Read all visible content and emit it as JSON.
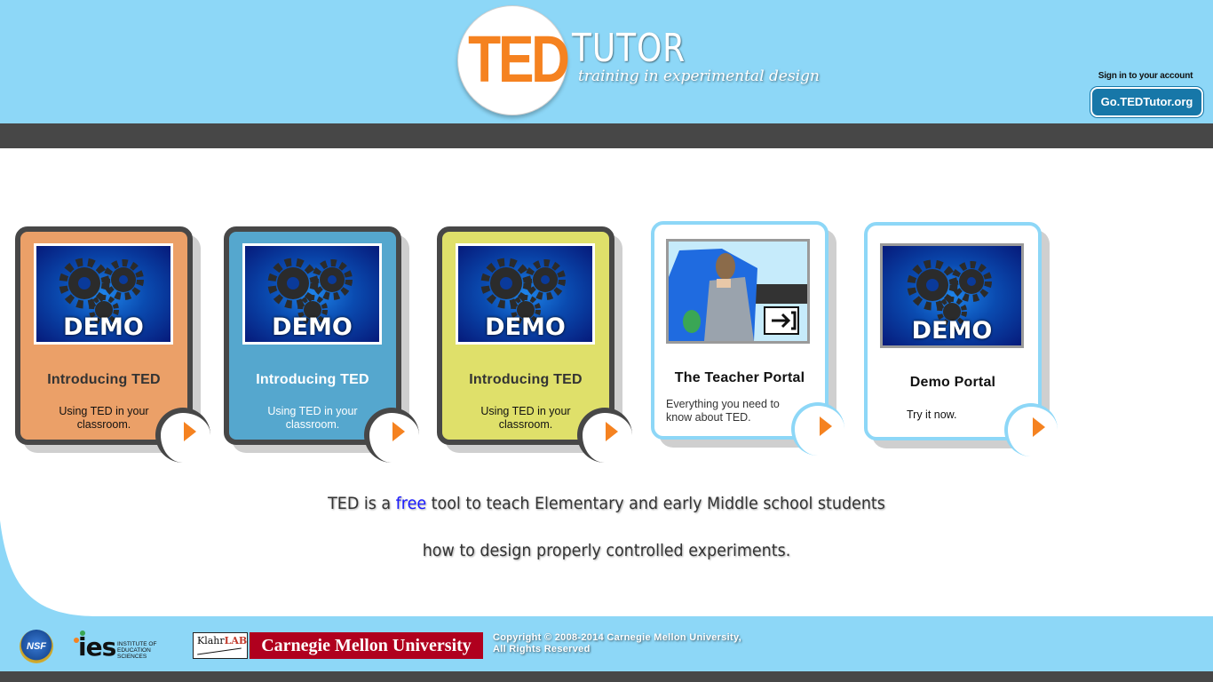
{
  "header": {
    "logo_ted": "TED",
    "logo_tutor": "TUTOR",
    "logo_tagline": "training in experimental design",
    "signin_text": "Sign in to your account",
    "signin_button": "Go.TEDTutor.org"
  },
  "cards": [
    {
      "thumb_word": "DEMO",
      "title": "Introducing TED",
      "desc": "Using TED in your classroom.",
      "bg": "#eba068"
    },
    {
      "thumb_word": "DEMO",
      "title": "Introducing TED",
      "desc": "Using TED in your classroom.",
      "bg": "#55a7ce"
    },
    {
      "thumb_word": "DEMO",
      "title": "Introducing TED",
      "desc": "Using TED in your classroom.",
      "bg": "#dfe06a"
    },
    {
      "title": "The Teacher Portal",
      "desc": "Everything you need to know about TED."
    },
    {
      "thumb_word": "DEMO",
      "title": "Demo Portal",
      "desc": "Try it now."
    }
  ],
  "tagline": {
    "line1_pre": "TED is a ",
    "line1_free": "free",
    "line1_post": " tool to teach Elementary and early Middle school students",
    "line2": "how to design properly controlled experiments."
  },
  "footer": {
    "nsf": "NSF",
    "ies": "ies",
    "ies_sub": "INSTITUTE OF EDUCATION SCIENCES",
    "klahr_a": "Klahr",
    "klahr_b": "LAB",
    "cmu": "Carnegie Mellon University",
    "copyright_line1": "Copyright © 2008-2014 Carnegie Mellon University,",
    "copyright_line2": "All Rights Reserved"
  },
  "colors": {
    "header_blue": "#8dd7f7",
    "dark_bar": "#474747",
    "accent_orange": "#f58220",
    "button_blue": "#1777a8",
    "cmu_red": "#b0001e"
  }
}
